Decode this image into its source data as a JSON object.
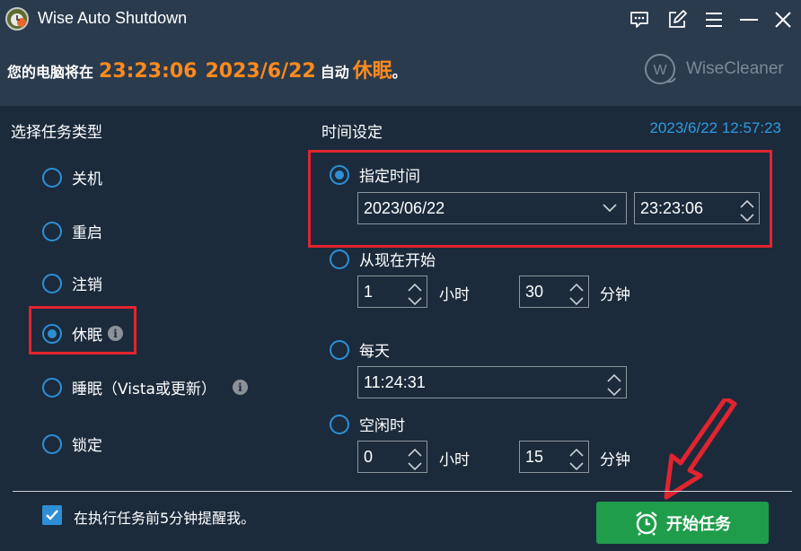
{
  "window": {
    "title": "Wise Auto Shutdown",
    "icons": [
      "app-logo-icon",
      "feedback-icon",
      "edit-icon",
      "menu-icon",
      "minimize-icon",
      "close-icon"
    ]
  },
  "header": {
    "prefix": "您的电脑将在",
    "time": "23:23:06",
    "date": "2023/6/22",
    "middle": "自动",
    "action": "休眠",
    "suffix": "。",
    "brand": "WiseCleaner",
    "brand_mark": "W"
  },
  "task_type": {
    "label": "选择任务类型",
    "selected": "休眠",
    "options": [
      {
        "label": "关机",
        "selected": false,
        "info": false
      },
      {
        "label": "重启",
        "selected": false,
        "info": false
      },
      {
        "label": "注销",
        "selected": false,
        "info": false
      },
      {
        "label": "休眠",
        "selected": true,
        "info": true
      },
      {
        "label": "睡眠（Vista或更新）",
        "selected": false,
        "info": true
      },
      {
        "label": "锁定",
        "selected": false,
        "info": false
      }
    ],
    "info_glyph": "i"
  },
  "time_settings": {
    "label": "时间设定",
    "current_datetime": "2023/6/22 12:57:23",
    "specified": {
      "label": "指定时间",
      "selected": true,
      "date_value": "2023/06/22",
      "time_value": "23:23:06"
    },
    "from_now": {
      "label": "从现在开始",
      "selected": false,
      "hours_value": "1",
      "hours_unit": "小时",
      "minutes_value": "30",
      "minutes_unit": "分钟"
    },
    "daily": {
      "label": "每天",
      "selected": false,
      "time_value": "11:24:31"
    },
    "idle": {
      "label": "空闲时",
      "selected": false,
      "hours_value": "0",
      "hours_unit": "小时",
      "minutes_value": "15",
      "minutes_unit": "分钟"
    }
  },
  "footer": {
    "reminder_label": "在执行任务前5分钟提醒我。",
    "reminder_checked": true,
    "start_button": "开始任务"
  },
  "colors": {
    "background": "#1b2b3c",
    "header": "#2a3b4e",
    "accent_orange": "#ff8a1d",
    "accent_blue": "#2e8fd6",
    "clock_blue": "#2f9bdf",
    "highlight_red": "#e2242f",
    "button_green": "#1f9d4a"
  }
}
